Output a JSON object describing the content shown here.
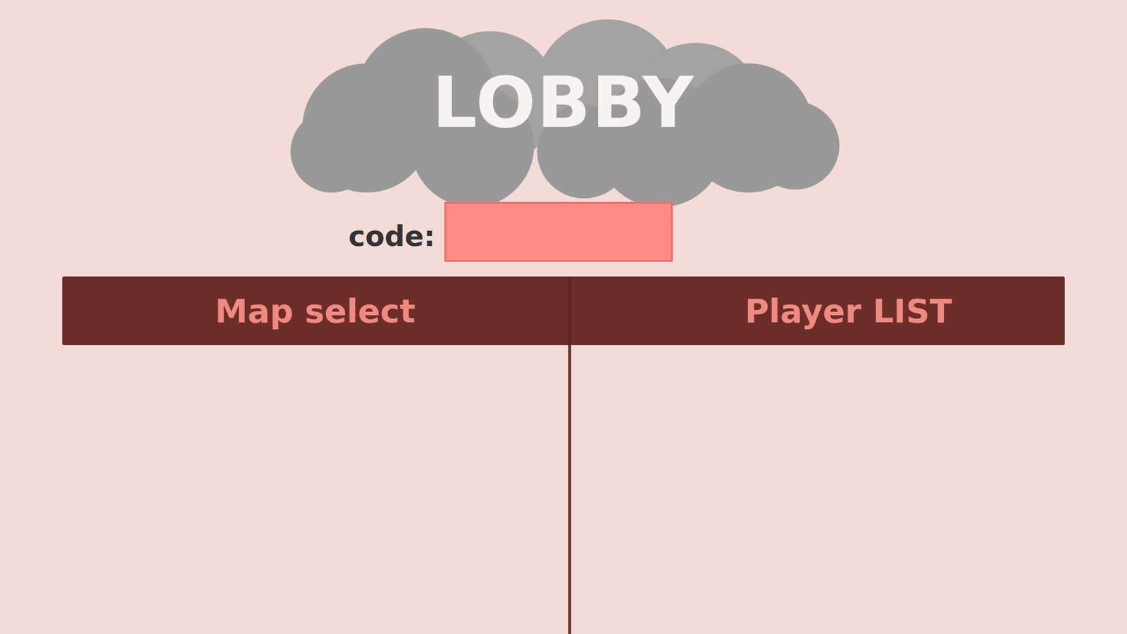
{
  "title": "LOBBY",
  "code": {
    "label": "code:",
    "value": ""
  },
  "panels": [
    {
      "title": "Map select"
    },
    {
      "title": "Player LIST"
    }
  ]
}
